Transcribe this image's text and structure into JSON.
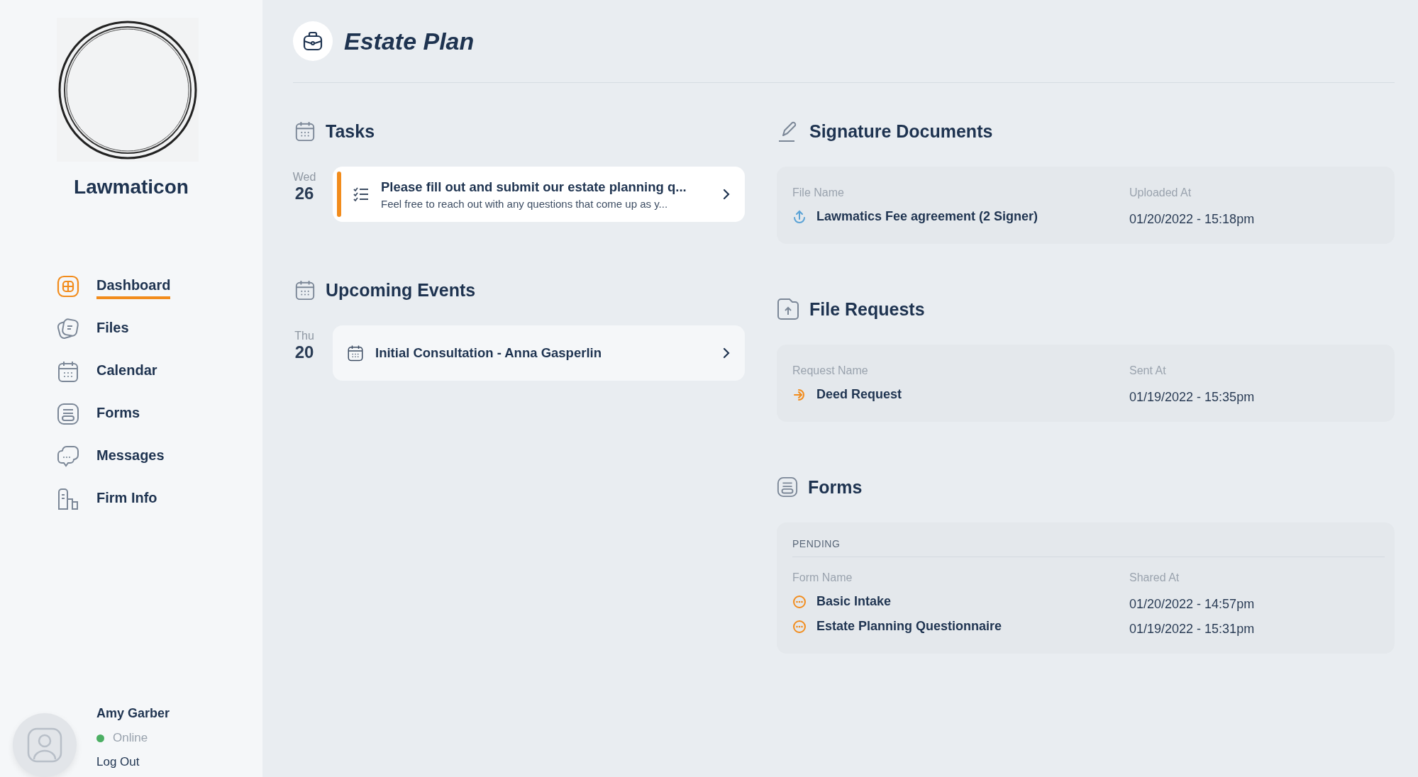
{
  "sidebar": {
    "firm_name": "Lawmaticon",
    "nav": [
      {
        "label": "Dashboard",
        "kind": "dashboard",
        "selected": true
      },
      {
        "label": "Files",
        "kind": "files",
        "selected": false
      },
      {
        "label": "Calendar",
        "kind": "calendar",
        "selected": false
      },
      {
        "label": "Forms",
        "kind": "forms",
        "selected": false
      },
      {
        "label": "Messages",
        "kind": "messages",
        "selected": false
      },
      {
        "label": "Firm Info",
        "kind": "firm",
        "selected": false
      }
    ],
    "user": {
      "name": "Amy Garber",
      "status": "Online",
      "online": true,
      "logout": "Log Out"
    }
  },
  "page": {
    "title": "Estate Plan"
  },
  "tasks": {
    "title": "Tasks",
    "items": [
      {
        "day": "Wed",
        "date": "26",
        "title": "Please fill out and submit our estate planning q...",
        "subtitle": "Feel free to reach out with any questions that come up as y..."
      }
    ]
  },
  "events": {
    "title": "Upcoming Events",
    "items": [
      {
        "day": "Thu",
        "date": "20",
        "title": "Initial Consultation - Anna Gasperlin"
      }
    ]
  },
  "signature_documents": {
    "title": "Signature Documents",
    "columns": [
      "File Name",
      "Uploaded At"
    ],
    "rows": [
      {
        "kind": "upload",
        "name": "Lawmatics Fee agreement (2 Signer)",
        "time": "01/20/2022 - 15:18pm"
      }
    ]
  },
  "file_requests": {
    "title": "File Requests",
    "columns": [
      "Request Name",
      "Sent At"
    ],
    "rows": [
      {
        "kind": "request",
        "name": "Deed Request",
        "time": "01/19/2022 - 15:35pm"
      }
    ]
  },
  "forms": {
    "title": "Forms",
    "group": "PENDING",
    "columns": [
      "Form Name",
      "Shared At"
    ],
    "rows": [
      {
        "kind": "pending",
        "name": "Basic Intake",
        "time": "01/20/2022 - 14:57pm"
      },
      {
        "kind": "pending",
        "name": "Estate Planning Questionnaire",
        "time": "01/19/2022 - 15:31pm"
      }
    ]
  }
}
